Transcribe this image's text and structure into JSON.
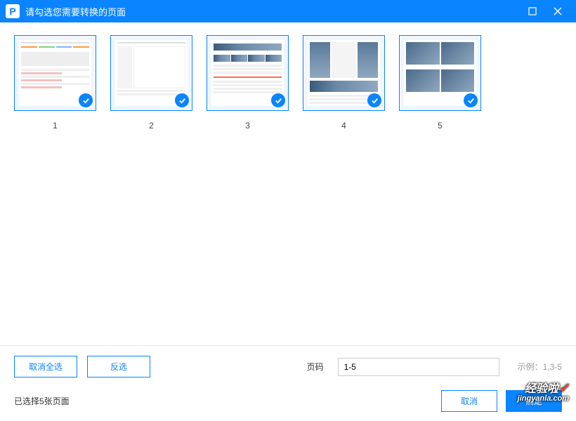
{
  "titlebar": {
    "title": "请勾选您需要转换的页面"
  },
  "thumbnails": [
    {
      "num": "1"
    },
    {
      "num": "2"
    },
    {
      "num": "3"
    },
    {
      "num": "4"
    },
    {
      "num": "5"
    }
  ],
  "footer": {
    "deselect_all": "取消全选",
    "invert": "反选",
    "page_label": "页码",
    "page_value": "1-5",
    "example_label": "示例：1,3-5",
    "selected_text": "已选择5张页面",
    "cancel": "取消",
    "confirm": "确定"
  },
  "watermark": {
    "line1a": "经验啦",
    "line1b": "✓",
    "line2": "jingyanla.com"
  }
}
